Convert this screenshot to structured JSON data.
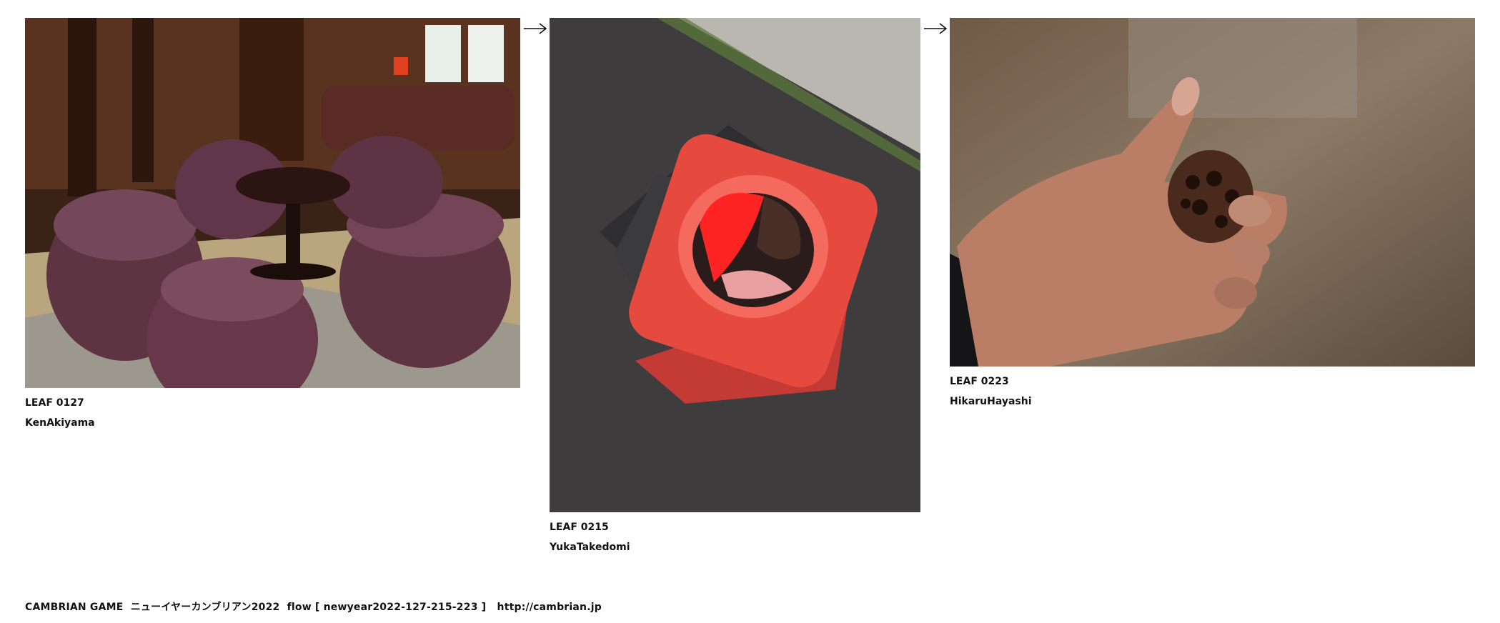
{
  "leaves": [
    {
      "id": "LEAF 0127",
      "author": "KenAkiyama",
      "photo": "lounge-chairs-photo"
    },
    {
      "id": "LEAF 0215",
      "author": "YukaTakedomi",
      "photo": "crushed-traffic-cone-photo"
    },
    {
      "id": "LEAF 0223",
      "author": "HikaruHayashi",
      "photo": "hand-holding-lotus-pod-photo"
    }
  ],
  "footer": {
    "text": "CAMBRIAN GAME  ニューイヤーカンブリアン2022  flow [ newyear2022-127-215-223 ]   ",
    "link": "http://cambrian.jp"
  },
  "arrow_icon": "right-arrow-icon"
}
